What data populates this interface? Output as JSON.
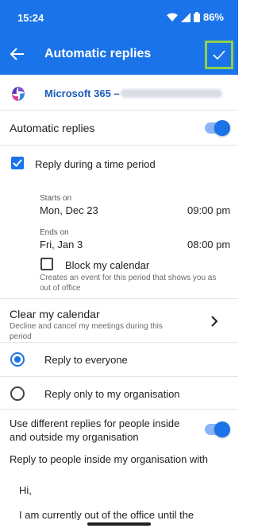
{
  "status_bar": {
    "time": "15:24",
    "battery": "86%"
  },
  "app_bar": {
    "title": "Automatic replies"
  },
  "account": {
    "name": "Microsoft 365 –"
  },
  "automatic_replies": {
    "label": "Automatic replies",
    "enabled": true
  },
  "time_period": {
    "label": "Reply during a time period",
    "checked": true,
    "starts_label": "Starts on",
    "starts_date": "Mon, Dec 23",
    "starts_time": "09:00 pm",
    "ends_label": "Ends on",
    "ends_date": "Fri, Jan 3",
    "ends_time": "08:00 pm"
  },
  "block_calendar": {
    "label": "Block my calendar",
    "checked": false,
    "description": "Creates an event for this period that shows you as out of office"
  },
  "clear_calendar": {
    "label": "Clear my calendar",
    "description": "Decline and cancel my meetings during this period"
  },
  "reply_scope": {
    "everyone": "Reply to everyone",
    "organisation": "Reply only to my organisation",
    "selected": "everyone"
  },
  "different_replies": {
    "label": "Use different replies for people inside and outside my organisation",
    "enabled": true
  },
  "inside_reply": {
    "heading": "Reply to people inside my organisation with",
    "greeting": "Hi,",
    "message_start": "I am currently out of the office until the"
  },
  "colors": {
    "accent": "#1a73e8",
    "highlight": "#8dd14a"
  }
}
